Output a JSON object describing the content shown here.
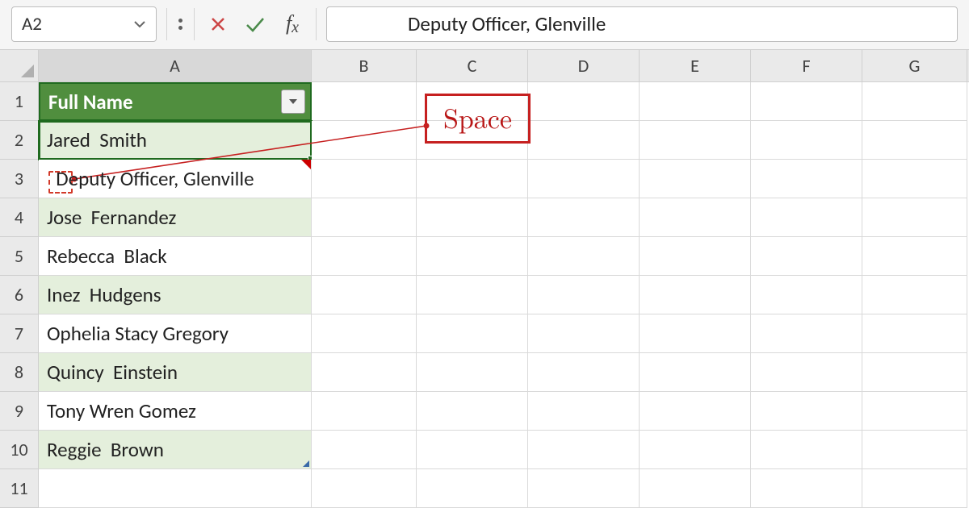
{
  "namebox": {
    "value": "A2"
  },
  "formula": {
    "value": "Deputy Officer, Glenville"
  },
  "columns": [
    "A",
    "B",
    "C",
    "D",
    "E",
    "F",
    "G"
  ],
  "row_numbers": [
    "1",
    "2",
    "3",
    "4",
    "5",
    "6",
    "7",
    "8",
    "9",
    "10",
    "11"
  ],
  "table": {
    "header": "Full Name",
    "rows": [
      "Jared  Smith",
      "  Deputy Officer, Glenville",
      "Jose  Fernandez",
      "Rebecca  Black",
      "Inez  Hudgens",
      "Ophelia Stacy Gregory",
      "Quincy  Einstein",
      "Tony Wren Gomez",
      "Reggie  Brown"
    ]
  },
  "annotation": {
    "label": "Space"
  }
}
